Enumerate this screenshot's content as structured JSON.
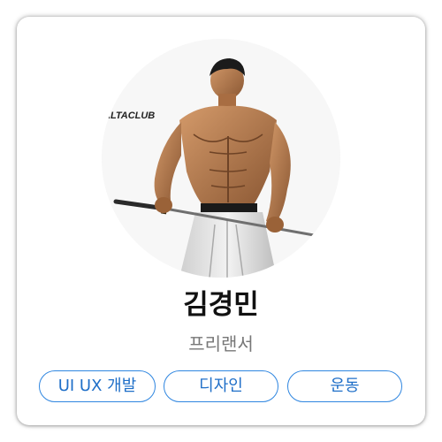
{
  "profile": {
    "name": "김경민",
    "role": "프리랜서",
    "photo_watermark": "ALTACLUB"
  },
  "tags": [
    {
      "label": "UI UX 개발"
    },
    {
      "label": "디자인"
    },
    {
      "label": "운동"
    }
  ],
  "colors": {
    "tag_border": "#2f86e0",
    "tag_text": "#1f6fc8",
    "name_text": "#111111",
    "role_text": "#777777"
  }
}
